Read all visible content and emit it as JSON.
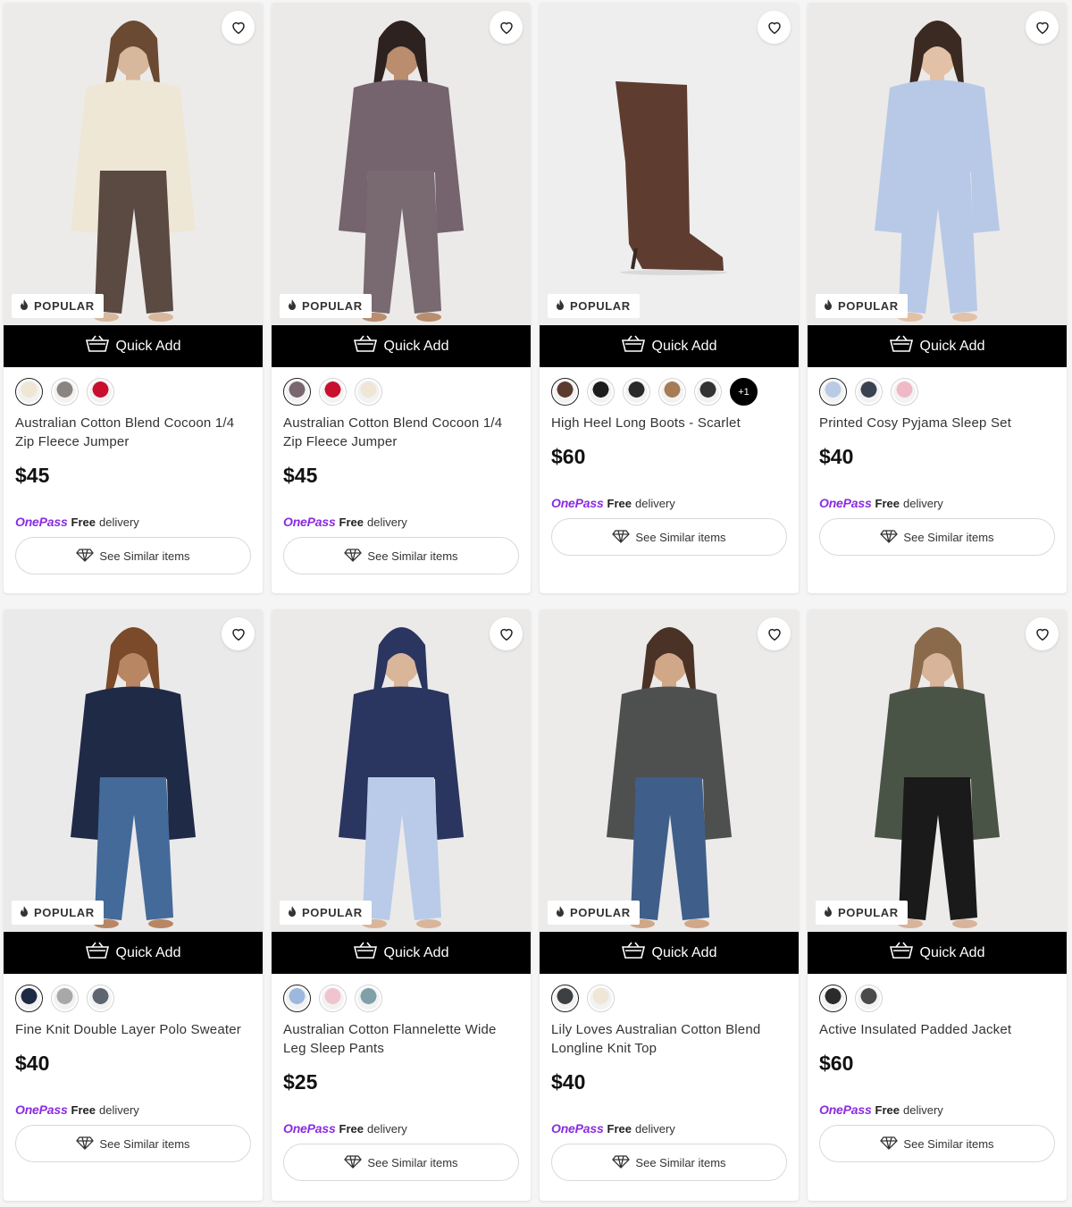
{
  "products": [
    {
      "title": "Australian Cotton Blend Cocoon 1/4 Zip Fleece Jumper",
      "price": "$45",
      "badge": "POPULAR",
      "quick_add": "Quick Add",
      "swatches": [
        "#efe6d6",
        "#8a8580",
        "#c8102e"
      ],
      "more": "",
      "onepass": "OnePass",
      "free": "Free",
      "delivery": "delivery",
      "similar": "See Similar items",
      "photo": {
        "bg": "#ecebea",
        "top": "#efe7d6",
        "bottom": "#5a4a42",
        "skin": "#d8b89c",
        "hair": "#6b4a33"
      }
    },
    {
      "title": "Australian Cotton Blend Cocoon 1/4 Zip Fleece Jumper",
      "price": "$45",
      "badge": "POPULAR",
      "quick_add": "Quick Add",
      "swatches": [
        "#7a6670",
        "#c8102e",
        "#efe6d6"
      ],
      "more": "",
      "onepass": "OnePass",
      "free": "Free",
      "delivery": "delivery",
      "similar": "See Similar items",
      "photo": {
        "bg": "#ebeae8",
        "top": "#75636e",
        "bottom": "#786a70",
        "skin": "#b98d6e",
        "hair": "#2e2220"
      }
    },
    {
      "title": "High Heel Long Boots - Scarlet",
      "price": "$60",
      "badge": "POPULAR",
      "quick_add": "Quick Add",
      "swatches": [
        "#5b3b2e",
        "#1c1c1c",
        "#2a2a2a",
        "#a57c55",
        "#333333"
      ],
      "more": "+1",
      "onepass": "OnePass",
      "free": "Free",
      "delivery": "delivery",
      "similar": "See Similar items",
      "photo": {
        "bg": "#eeeeee",
        "top": "#5e3d30",
        "bottom": "#5e3d30",
        "skin": "#5e3d30",
        "hair": "#5e3d30"
      }
    },
    {
      "title": "Printed Cosy Pyjama Sleep Set",
      "price": "$40",
      "badge": "POPULAR",
      "quick_add": "Quick Add",
      "swatches": [
        "#b9cbe4",
        "#3a4252",
        "#f0b9c6"
      ],
      "more": "",
      "onepass": "OnePass",
      "free": "Free",
      "delivery": "delivery",
      "similar": "See Similar items",
      "photo": {
        "bg": "#ebeae8",
        "top": "#b7c9e6",
        "bottom": "#b7c9e6",
        "skin": "#e2c1a6",
        "hair": "#3a2a22"
      }
    },
    {
      "title": "Fine Knit Double Layer Polo Sweater",
      "price": "$40",
      "badge": "POPULAR",
      "quick_add": "Quick Add",
      "swatches": [
        "#1e2a44",
        "#a8a8a8",
        "#5d6670"
      ],
      "more": "",
      "onepass": "OnePass",
      "free": "Free",
      "delivery": "delivery",
      "similar": "See Similar items",
      "photo": {
        "bg": "#ebeaea",
        "top": "#1f2a47",
        "bottom": "#446a9a",
        "skin": "#b98663",
        "hair": "#7a4a2a"
      }
    },
    {
      "title": "Australian Cotton Flannelette Wide Leg Sleep Pants",
      "price": "$25",
      "badge": "POPULAR",
      "quick_add": "Quick Add",
      "swatches": [
        "#9db8de",
        "#f0c4ce",
        "#7fa0a8"
      ],
      "more": "",
      "onepass": "OnePass",
      "free": "Free",
      "delivery": "delivery",
      "similar": "See Similar items",
      "photo": {
        "bg": "#ebeae8",
        "top": "#2a3560",
        "bottom": "#b9cbe8",
        "skin": "#d9b59a",
        "hair": "#2a3560"
      }
    },
    {
      "title": "Lily Loves Australian Cotton Blend Longline Knit Top",
      "price": "$40",
      "badge": "POPULAR",
      "quick_add": "Quick Add",
      "swatches": [
        "#3c4042",
        "#efe6d6"
      ],
      "more": "",
      "onepass": "OnePass",
      "free": "Free",
      "delivery": "delivery",
      "similar": "See Similar items",
      "photo": {
        "bg": "#ecebea",
        "top": "#4d504f",
        "bottom": "#3f5f8a",
        "skin": "#d0a888",
        "hair": "#4a3226"
      }
    },
    {
      "title": "Active Insulated Padded Jacket",
      "price": "$60",
      "badge": "POPULAR",
      "quick_add": "Quick Add",
      "swatches": [
        "#2b2b2b",
        "#4a4a4a"
      ],
      "more": "",
      "onepass": "OnePass",
      "free": "Free",
      "delivery": "delivery",
      "similar": "See Similar items",
      "photo": {
        "bg": "#ecebea",
        "top": "#4a5446",
        "bottom": "#1a1a1a",
        "skin": "#d8b49a",
        "hair": "#8a6a4a"
      }
    }
  ]
}
